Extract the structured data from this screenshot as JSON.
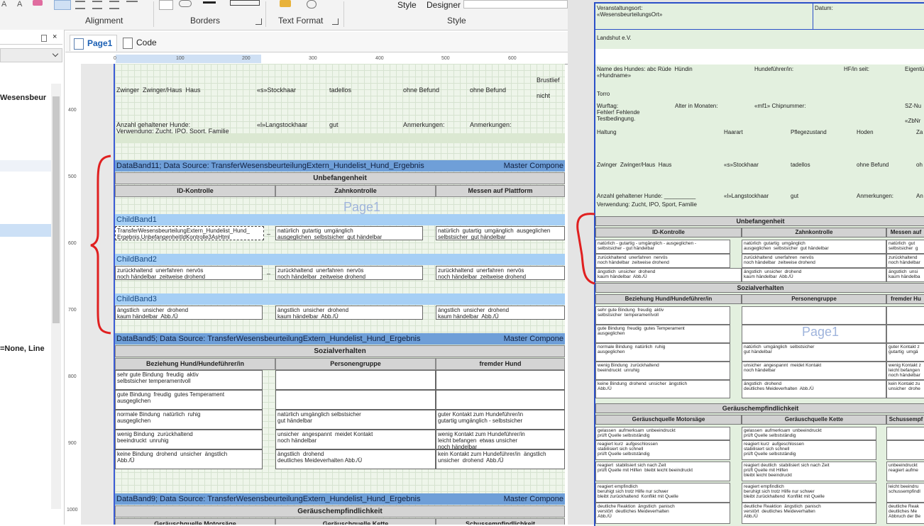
{
  "ribbon": {
    "groups": [
      "Alignment",
      "Borders",
      "Text Format",
      "Style"
    ],
    "style_label": "Style",
    "designer_label": "Designer"
  },
  "tabs": [
    {
      "label": "Page1"
    },
    {
      "label": "Code"
    }
  ],
  "left_panel": {
    "texts": [
      "Wesensbeur",
      "=None, Line"
    ]
  },
  "ruler_h": [
    "0",
    "100",
    "200",
    "300",
    "400",
    "500",
    "600"
  ],
  "ruler_v": [
    "400",
    "500",
    "600",
    "700",
    "800",
    "900",
    "1000"
  ],
  "designer": {
    "top": {
      "brust": "Brustlief",
      "nicht": "nicht",
      "row1": [
        "Zwinger  Zwinger/Haus  Haus",
        "«s»Stockhaar",
        "tadellos",
        "ohne Befund",
        "ohne Befund"
      ],
      "row2": [
        "Anzahl gehaltener Hunde:",
        "«l»Langstockhaar",
        "gut",
        "Anmerkungen:",
        "Anmerkungen:"
      ],
      "row3": "Verwendung: Zucht, IPO, Sport, Familie"
    },
    "band11": {
      "label": "DataBand11; Data Source: TransferWesensbeurteilungExtern_Hundelist_Hund_Ergebnis",
      "right": "Master Compone"
    },
    "unbefangenheit": "Unbefangenheit",
    "cols1": [
      "ID-Kontrolle",
      "Zahnkontrolle",
      "Messen auf Plattform"
    ],
    "watermark": "Page1",
    "child1": "ChildBand1",
    "child1_cells": [
      "TransferWesensbeurteilungExtern_Hundelist_Hund_\nErgebnis.UnbefangenheitIdKontrolle3AsHtml",
      "natürlich  gutartig  umgänglich\nausgeglichen  selbstsicher  gut händelbar",
      "natürlich  gutartig  umgänglich  ausgeglichen\nselbstsicher  gut händelbar"
    ],
    "child2": "ChildBand2",
    "child2_cells": [
      "zurückhaltend  unerfahren  nervös\nnoch händelbar  zeitweise drohend",
      "zurückhaltend  unerfahren  nervös\nnoch händelbar  zeitweise drohend",
      "zurückhaltend  unerfahren  nervös\nnoch händelbar  zeitweise drohend"
    ],
    "child3": "ChildBand3",
    "child3_cells": [
      "ängstlich  unsicher  drohend\nkaum händelbar  Abb./Ü",
      "ängstlich  unsicher  drohend\nkaum händelbar  Abb./Ü",
      "ängstlich  unsicher  drohend\nkaum händelbar  Abb./Ü"
    ],
    "dash": "–",
    "band5": {
      "label": "DataBand5; Data Source: TransferWesensbeurteilungExtern_Hundelist_Hund_Ergebnis",
      "right": "Master Compone"
    },
    "sozialverhalten": "Sozialverhalten",
    "cols2": [
      "Beziehung Hund/Hundeführer/in",
      "Personengruppe",
      "fremder Hund"
    ],
    "soz_rows": [
      [
        "sehr gute Bindung  freudig  aktiv\nselbstsicher temperamentvoll",
        "",
        ""
      ],
      [
        "gute Bindung  freudig  gutes Temperament\nausgeglichen",
        "",
        ""
      ],
      [
        "normale Bindung  natürlich  ruhig\nausgeglichen",
        "natürlich umgänglich selbstsicher\ngut händelbar",
        "guter Kontakt zum Hundeführer/in\ngutartig umgänglich - selbstsicher"
      ],
      [
        "wenig Bindung  zurückhaltend\nbeeindruckt  unruhig",
        "unsicher  angespannt  meidet Kontakt\nnoch händelbar",
        "wenig Kontakt zum Hundeführer/in\nleicht befangen  etwas unsicher\nnoch händelbar"
      ],
      [
        "keine Bindung  drohend  unsicher  ängstlich\nAbb./Ü",
        "ängstlich  drohend\ndeutliches Meideverhalten Abb./Ü",
        "kein Kontakt zum Hundeführer/in  ängstlich\nunsicher  drohend  Abb./Ü"
      ]
    ],
    "band9": {
      "label": "DataBand9; Data Source: TransferWesensbeurteilungExtern_Hundelist_Hund_Ergebnis",
      "right": "Master Compone"
    },
    "geraeusch": "Geräuschempfindlichkeit",
    "cols3": [
      "Geräuschquelle Motorsäge",
      "Geräuschquelle Kette",
      "Schussempfindlichkeit"
    ]
  },
  "preview": {
    "veranstaltungsort": "Veranstaltungsort:\n«WesensbeurteilungsOrt»",
    "datum": "Datum:",
    "verein": "Landshut e.V.",
    "hund_line": "Name des Hundes: abc Rüde  Hündin\n«Hundname»",
    "hundefuehrer": "Hundeführer/in:",
    "hf_seit": "HF/in seit:",
    "eigentuemer": "Eigentü",
    "torro": "Torro",
    "wurftag": "Wurftag:\nFehler! Fehlende\nTestbedingung.",
    "alter": "Alter in Monaten:",
    "chip": "«mf1» Chipnummer:",
    "sz": "SZ-Nu",
    "zbnr": "«ZbNr",
    "haltung_row": [
      "Haltung",
      "Haarart",
      "Pflegezustand",
      "Hoden",
      "Za"
    ],
    "zwinger_row": [
      "Zwinger  Zwinger/Haus  Haus",
      "«s»Stockhaar",
      "tadellos",
      "ohne Befund",
      "oh"
    ],
    "anzahl_row": [
      "Anzahl gehaltener Hunde: __________",
      "«l»Langstockhaar",
      "gut",
      "Anmerkungen:",
      "An"
    ],
    "verwendung": "Verwendung: Zucht, IPO, Sport, Familie",
    "unbefangenheit": "Unbefangenheit",
    "cols1": [
      "ID-Kontrolle",
      "Zahnkontrolle",
      "Messen auf"
    ],
    "unb_rows": [
      [
        "natürlich - gutartig - umgänglich - ausgeglichen -\nselbstsicher - gut händelbar",
        "natürlich  gutartig  umgänglich\nausgeglichen  selbstsicher  gut händelbar",
        "natürlich  gut\nselbstsicher  g"
      ],
      [
        "zurückhaltend  unerfahren  nervös\nnoch händelbar  zeitweise drohend",
        "zurückhaltend  unerfahren  nervös\nnoch händelbar  zeitweise drohend",
        "zurückhaltend\nnoch händelbar"
      ],
      [
        "ängstlich  unsicher  drohend\nkaum händelbar  Abb./Ü",
        "ängstlich  unsicher  drohend\nkaum händelbar  Abb./Ü",
        "ängstlich  unsi\nkaum händelba"
      ]
    ],
    "sozialverhalten": "Sozialverhalten",
    "cols2": [
      "Beziehung Hund/Hundeführer/in",
      "Personengruppe",
      "fremder Hu"
    ],
    "watermark": "Page1",
    "soz_rows": [
      [
        "sehr gute Bindung  freudig  aktiv\nselbstsicher  temperamentvoll",
        "",
        ""
      ],
      [
        "gute Bindung  freudig  gutes Temperament\nausgeglichen",
        "",
        ""
      ],
      [
        "normale Bindung  natürlich  ruhig\nausgeglichen",
        "natürlich  umgänglich  selbstsicher\ngut händelbar",
        "guter Kontakt z\ngutartig  umgä"
      ],
      [
        "wenig Bindung  zurückhaltend\nbeeindruckt  unruhig",
        "unsicher  angespannt  meidet Kontakt\nnoch händelbar",
        "wenig Kontakt z\nleicht befangen\nnoch händelbar"
      ],
      [
        "keine Bindung  drohend  unsicher  ängstlich\nAbb./Ü",
        "ängstlich  drohend\ndeutliches Meideverhalten  Abb./Ü",
        "kein Kontakt zu\nunsicher  drohe"
      ]
    ],
    "geraeusch": "Geräuschempfindlichkeit",
    "cols3": [
      "Geräuschquelle Motorsäge",
      "Geräuschquelle Kette",
      "Schussempf"
    ],
    "ger_rows": [
      [
        "gelassen  aufmerksam  unbeeindruckt\nprüft Quelle selbstständig",
        "gelassen  aufmerksam  unbeeindruckt\nprüft Quelle selbstständig",
        ""
      ],
      [
        "reagiert kurz  aufgeschlossen\nstabilisiert sich schnell\nprüft Quelle selbstständig",
        "reagiert kurz  aufgeschlossen\nstabilisiert sich schnell\nprüft Quelle selbstständig",
        ""
      ],
      [
        "reagiert  stabilisiert sich nach Zeit\nprüft Quelle mit Hilfen  bleibt leicht beeindruckt",
        "reagiert deutlich  stabilisiert sich nach Zeit\nprüft Quelle mit Hilfen\nbleibt leicht beeindruckt",
        "unbeeindruckt\nreagiert aufme"
      ],
      [
        "reagiert empfindlich\nberuhigt sich trotz Hilfe nur schwer\nbleibt zurückhaltend  Konflikt mit Quelle",
        "reagiert empfindlich\nberuhigt sich trotz Hilfe nur schwer\nbleibt zurückhaltend  Konflikt mit Quelle",
        "leicht beeindru\nschussempfindl"
      ],
      [
        "deutliche Reaktion  ängstlich  panisch\nverstört  deutliches Meideverhalten\nAbb./Ü",
        "deutliche Reaktion  ängstlich  panisch\nverstört  deutliches Meideverhalten\nAbb./Ü",
        "deutliche Reak\ndeutliches Me\nAbbruch der Be"
      ]
    ]
  }
}
